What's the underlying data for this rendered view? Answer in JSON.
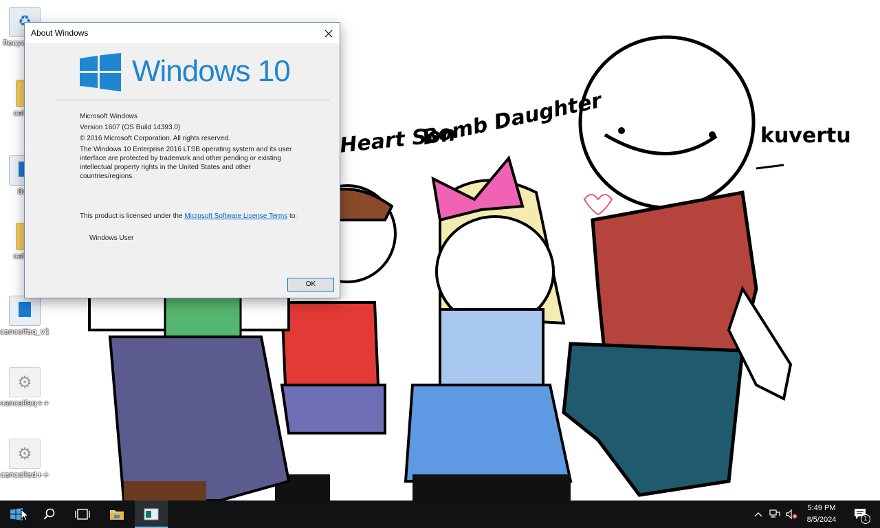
{
  "desktop": {
    "icons": [
      {
        "label": "Recycle Bin",
        "icon": "recycle-bin-icon"
      },
      {
        "label": "calubj",
        "icon": "folder-icon"
      },
      {
        "label": "8aY",
        "icon": "app-icon"
      },
      {
        "label": "calubj",
        "icon": "folder-icon"
      },
      {
        "label": "cancelfaq_v1",
        "icon": "document-icon"
      },
      {
        "label": "cancelfaq++",
        "icon": "settings-file-icon"
      },
      {
        "label": "cancelled++",
        "icon": "settings-file-icon"
      }
    ],
    "wallpaper_labels": {
      "heart_son": "Heart Son",
      "bomb_daughter": "Bomb Daughter",
      "kuvertu": "kuvertu"
    }
  },
  "dialog": {
    "title": "About Windows",
    "logo_text": "Windows 10",
    "product": "Microsoft Windows",
    "version": "Version 1607 (OS Build 14393.0)",
    "copyright": "© 2016 Microsoft Corporation. All rights reserved.",
    "legal": "The Windows 10 Enterprise 2016 LTSB operating system and its user interface are protected by trademark and other pending or existing intellectual property rights in the United States and other countries/regions.",
    "license_prefix": "This product is licensed under the ",
    "license_link": "Microsoft Software License Terms",
    "license_suffix": " to:",
    "licensed_user": "Windows User",
    "ok_label": "OK"
  },
  "taskbar": {
    "clock_time": "5:49 PM",
    "clock_date": "8/5/2024",
    "notification_count": "1",
    "buttons": [
      "start-icon",
      "search-icon",
      "task-view-icon",
      "file-explorer-icon",
      "winver-app-icon"
    ]
  },
  "colors": {
    "taskbar": "#101214",
    "accent": "#0078d7",
    "windows_blue": "#1f86d0"
  }
}
